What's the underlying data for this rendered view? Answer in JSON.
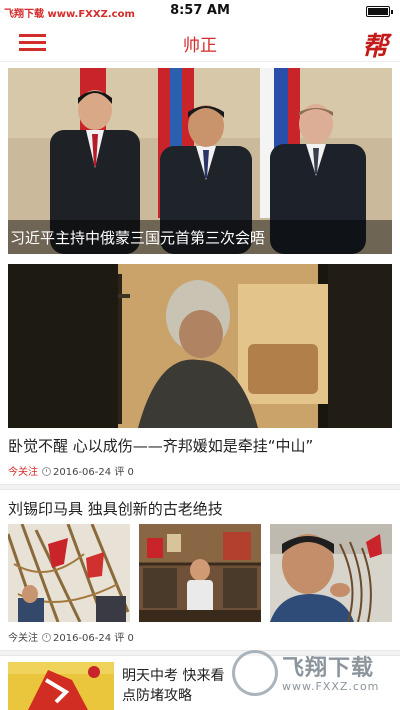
{
  "status_bar": {
    "watermark": "飞翔下载 www.FXXZ.com",
    "time": "8:57 AM"
  },
  "navbar": {
    "title": "帅正",
    "logo_text": "帮",
    "accent_color": "#d42b2b"
  },
  "articles": [
    {
      "caption": "习近平主持中俄蒙三国元首第三次会晤"
    },
    {
      "title": "卧觉不醒 心以成伤——齐邦媛如是牵挂“中山”",
      "tag": "今关注",
      "date": "2016-06-24",
      "comments": "评 0"
    },
    {
      "title": "刘锡印马具 独具创新的古老绝技",
      "tag": "今关注",
      "date": "2016-06-24",
      "comments": "评 0"
    },
    {
      "title": "明天中考 快来看 点防堵攻略"
    }
  ],
  "watermark_logo": {
    "big": "飞翔下载",
    "small": "www.FXXZ.com"
  }
}
